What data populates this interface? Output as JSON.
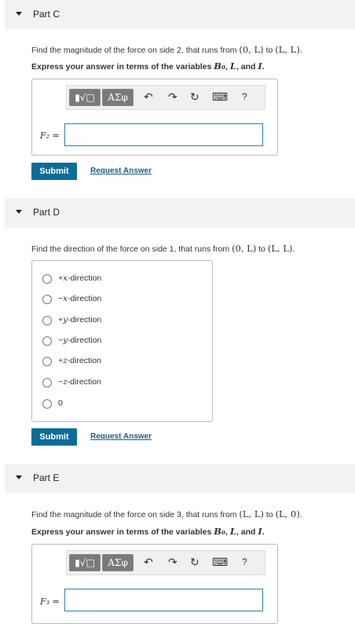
{
  "part_c": {
    "title": "Part C",
    "question": {
      "pre": "Find the magnitude of the force on side 2, that runs from ",
      "from": "(0, L)",
      "to_word": " to ",
      "to": "(L, L)",
      "end": "."
    },
    "instruction": {
      "pre": "Express your answer in terms of the variables ",
      "v1": "B₀",
      "sep1": ", ",
      "v2": "L",
      "sep2": ", and ",
      "v3": "I",
      "end": "."
    },
    "toolbar": {
      "templates": "▮√□",
      "symbols": "ΑΣφ",
      "undo": "↶",
      "redo": "↷",
      "reset": "↻",
      "keyboard": "⌨",
      "help": "?"
    },
    "variable_label": "F₂ =",
    "input_value": "",
    "submit_label": "Submit",
    "request_label": "Request Answer"
  },
  "part_d": {
    "title": "Part D",
    "question": {
      "pre": "Find the direction of the force on side 1, that runs from ",
      "from": "(0, L)",
      "to_word": " to ",
      "to": "(L, L)",
      "end": "."
    },
    "choices": [
      {
        "sign": "+",
        "axis": "x",
        "suffix": "-direction"
      },
      {
        "sign": "−",
        "axis": "x",
        "suffix": "-direction"
      },
      {
        "sign": "+",
        "axis": "y",
        "suffix": "-direction"
      },
      {
        "sign": "−",
        "axis": "y",
        "suffix": "-direction"
      },
      {
        "sign": "+",
        "axis": "z",
        "suffix": "-direction"
      },
      {
        "sign": "−",
        "axis": "z",
        "suffix": "-direction"
      },
      {
        "sign": "0",
        "axis": "",
        "suffix": ""
      }
    ],
    "submit_label": "Submit",
    "request_label": "Request Answer"
  },
  "part_e": {
    "title": "Part E",
    "question": {
      "pre": "Find the magnitude of the force on side 3, that runs from ",
      "from": "(L, L)",
      "to_word": " to ",
      "to": "(L, 0)",
      "end": "."
    },
    "instruction": {
      "pre": "Express your answer in terms of the variables ",
      "v1": "B₀",
      "sep1": ", ",
      "v2": "L",
      "sep2": ", and ",
      "v3": "I",
      "end": "."
    },
    "toolbar": {
      "templates": "▮√□",
      "symbols": "ΑΣφ",
      "undo": "↶",
      "redo": "↷",
      "reset": "↻",
      "keyboard": "⌨",
      "help": "?"
    },
    "variable_label": "F₃ =",
    "input_value": ""
  }
}
